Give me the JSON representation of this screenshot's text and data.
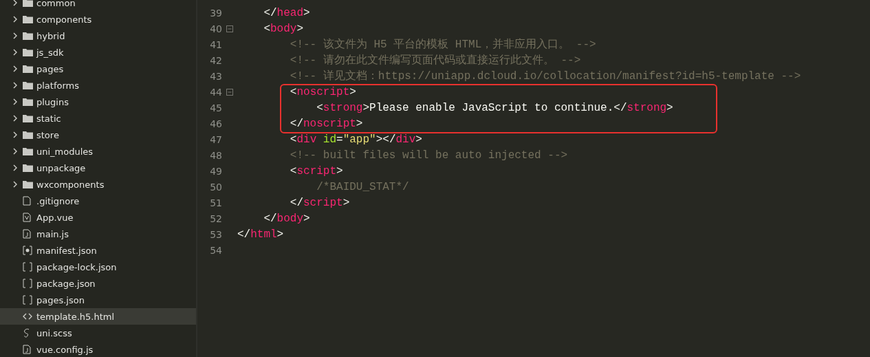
{
  "sidebar": {
    "items": [
      {
        "kind": "folder",
        "label": "common",
        "expanded": false,
        "selected": false
      },
      {
        "kind": "folder",
        "label": "components",
        "expanded": false,
        "selected": false
      },
      {
        "kind": "folder",
        "label": "hybrid",
        "expanded": false,
        "selected": false
      },
      {
        "kind": "folder",
        "label": "js_sdk",
        "expanded": false,
        "selected": false
      },
      {
        "kind": "folder",
        "label": "pages",
        "expanded": false,
        "selected": false
      },
      {
        "kind": "folder",
        "label": "platforms",
        "expanded": false,
        "selected": false
      },
      {
        "kind": "folder",
        "label": "plugins",
        "expanded": false,
        "selected": false
      },
      {
        "kind": "folder",
        "label": "static",
        "expanded": false,
        "selected": false
      },
      {
        "kind": "folder",
        "label": "store",
        "expanded": false,
        "selected": false
      },
      {
        "kind": "folder",
        "label": "uni_modules",
        "expanded": false,
        "selected": false
      },
      {
        "kind": "folder",
        "label": "unpackage",
        "expanded": false,
        "selected": false
      },
      {
        "kind": "folder",
        "label": "wxcomponents",
        "expanded": false,
        "selected": false
      },
      {
        "kind": "file",
        "label": ".gitignore",
        "selected": false
      },
      {
        "kind": "vue",
        "label": "App.vue",
        "selected": false
      },
      {
        "kind": "script",
        "label": "main.js",
        "selected": false
      },
      {
        "kind": "config",
        "label": "manifest.json",
        "selected": false
      },
      {
        "kind": "brackets",
        "label": "package-lock.json",
        "selected": false
      },
      {
        "kind": "brackets",
        "label": "package.json",
        "selected": false
      },
      {
        "kind": "brackets",
        "label": "pages.json",
        "selected": false
      },
      {
        "kind": "markup",
        "label": "template.h5.html",
        "selected": true
      },
      {
        "kind": "style",
        "label": "uni.scss",
        "selected": false
      },
      {
        "kind": "script",
        "label": "vue.config.js",
        "selected": false
      }
    ]
  },
  "editor": {
    "lines": [
      {
        "number": "39",
        "foldable": false,
        "highlighted": false,
        "tokens": [
          {
            "kind": "punct",
            "text": "    </"
          },
          {
            "kind": "tag",
            "text": "head"
          },
          {
            "kind": "punct",
            "text": ">"
          }
        ]
      },
      {
        "number": "40",
        "foldable": true,
        "highlighted": false,
        "tokens": [
          {
            "kind": "punct",
            "text": "    <"
          },
          {
            "kind": "tag",
            "text": "body"
          },
          {
            "kind": "punct",
            "text": ">"
          }
        ]
      },
      {
        "number": "41",
        "foldable": false,
        "highlighted": false,
        "tokens": [
          {
            "kind": "comment",
            "text": "        <!-- 该文件为 H5 平台的模板 HTML，并非应用入口。 -->"
          }
        ]
      },
      {
        "number": "42",
        "foldable": false,
        "highlighted": false,
        "tokens": [
          {
            "kind": "comment",
            "text": "        <!-- 请勿在此文件编写页面代码或直接运行此文件。 -->"
          }
        ]
      },
      {
        "number": "43",
        "foldable": false,
        "highlighted": false,
        "tokens": [
          {
            "kind": "comment",
            "text": "        <!-- 详见文档：https://uniapp.dcloud.io/collocation/manifest?id=h5-template -->"
          }
        ]
      },
      {
        "number": "44",
        "foldable": true,
        "highlighted": true,
        "tokens": [
          {
            "kind": "punct",
            "text": "        <"
          },
          {
            "kind": "tag",
            "text": "noscript"
          },
          {
            "kind": "punct",
            "text": ">"
          }
        ]
      },
      {
        "number": "45",
        "foldable": false,
        "highlighted": true,
        "tokens": [
          {
            "kind": "punct",
            "text": "            <"
          },
          {
            "kind": "tag",
            "text": "strong"
          },
          {
            "kind": "punct",
            "text": ">Please enable JavaScript to continue.</"
          },
          {
            "kind": "tag",
            "text": "strong"
          },
          {
            "kind": "punct",
            "text": ">"
          }
        ]
      },
      {
        "number": "46",
        "foldable": false,
        "highlighted": true,
        "tokens": [
          {
            "kind": "punct",
            "text": "        </"
          },
          {
            "kind": "tag",
            "text": "noscript"
          },
          {
            "kind": "punct",
            "text": ">"
          }
        ]
      },
      {
        "number": "47",
        "foldable": false,
        "highlighted": false,
        "tokens": [
          {
            "kind": "punct",
            "text": "        <"
          },
          {
            "kind": "tag",
            "text": "div"
          },
          {
            "kind": "attr",
            "text": " id"
          },
          {
            "kind": "punct",
            "text": "="
          },
          {
            "kind": "string",
            "text": "\"app\""
          },
          {
            "kind": "punct",
            "text": "></"
          },
          {
            "kind": "tag",
            "text": "div"
          },
          {
            "kind": "punct",
            "text": ">"
          }
        ]
      },
      {
        "number": "48",
        "foldable": false,
        "highlighted": false,
        "tokens": [
          {
            "kind": "comment",
            "text": "        <!-- built files will be auto injected -->"
          }
        ]
      },
      {
        "number": "49",
        "foldable": false,
        "highlighted": false,
        "tokens": [
          {
            "kind": "punct",
            "text": "        <"
          },
          {
            "kind": "tag",
            "text": "script"
          },
          {
            "kind": "punct",
            "text": ">"
          }
        ]
      },
      {
        "number": "50",
        "foldable": false,
        "highlighted": false,
        "tokens": [
          {
            "kind": "comment",
            "text": "            /*BAIDU_STAT*/"
          }
        ]
      },
      {
        "number": "51",
        "foldable": false,
        "highlighted": false,
        "tokens": [
          {
            "kind": "punct",
            "text": "        </"
          },
          {
            "kind": "tag",
            "text": "script"
          },
          {
            "kind": "punct",
            "text": ">"
          }
        ]
      },
      {
        "number": "52",
        "foldable": false,
        "highlighted": false,
        "tokens": [
          {
            "kind": "punct",
            "text": "    </"
          },
          {
            "kind": "tag",
            "text": "body"
          },
          {
            "kind": "punct",
            "text": ">"
          }
        ]
      },
      {
        "number": "53",
        "foldable": false,
        "highlighted": false,
        "tokens": [
          {
            "kind": "punct",
            "text": "</"
          },
          {
            "kind": "tag",
            "text": "html"
          },
          {
            "kind": "punct",
            "text": ">"
          }
        ]
      },
      {
        "number": "54",
        "foldable": false,
        "highlighted": false
      }
    ]
  }
}
